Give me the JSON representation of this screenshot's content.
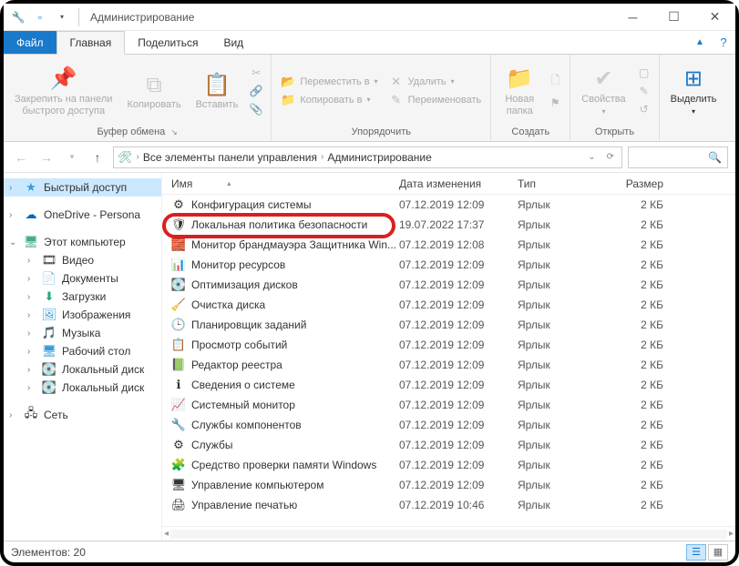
{
  "title": "Администрирование",
  "tabs": {
    "file": "Файл",
    "home": "Главная",
    "share": "Поделиться",
    "view": "Вид"
  },
  "ribbon": {
    "clipboard": {
      "pin": "Закрепить на панели\nбыстрого доступа",
      "copy": "Копировать",
      "paste": "Вставить",
      "label": "Буфер обмена"
    },
    "organize": {
      "moveTo": "Переместить в",
      "copyTo": "Копировать в",
      "delete": "Удалить",
      "rename": "Переименовать",
      "label": "Упорядочить"
    },
    "new": {
      "newFolder": "Новая\nпапка",
      "label": "Создать"
    },
    "open": {
      "props": "Свойства",
      "label": "Открыть"
    },
    "select": {
      "select": "Выделить",
      "label": ""
    }
  },
  "breadcrumb": {
    "root": "Все элементы панели управления",
    "current": "Администрирование"
  },
  "columns": {
    "name": "Имя",
    "date": "Дата изменения",
    "type": "Тип",
    "size": "Размер"
  },
  "nav": {
    "quick": "Быстрый доступ",
    "onedrive": "OneDrive - Persona",
    "pc": "Этот компьютер",
    "video": "Видео",
    "docs": "Документы",
    "downloads": "Загрузки",
    "pictures": "Изображения",
    "music": "Музыка",
    "desktop": "Рабочий стол",
    "disk1": "Локальный диск",
    "disk2": "Локальный диск",
    "network": "Сеть"
  },
  "items": [
    {
      "name": "Конфигурация системы",
      "date": "07.12.2019 12:09",
      "type": "Ярлык",
      "size": "2 КБ",
      "icon": "⚙"
    },
    {
      "name": "Локальная политика безопасности",
      "date": "19.07.2022 17:37",
      "type": "Ярлык",
      "size": "2 КБ",
      "icon": "🛡"
    },
    {
      "name": "Монитор брандмауэра Защитника Win...",
      "date": "07.12.2019 12:08",
      "type": "Ярлык",
      "size": "2 КБ",
      "icon": "🧱"
    },
    {
      "name": "Монитор ресурсов",
      "date": "07.12.2019 12:09",
      "type": "Ярлык",
      "size": "2 КБ",
      "icon": "📊"
    },
    {
      "name": "Оптимизация дисков",
      "date": "07.12.2019 12:09",
      "type": "Ярлык",
      "size": "2 КБ",
      "icon": "💽"
    },
    {
      "name": "Очистка диска",
      "date": "07.12.2019 12:09",
      "type": "Ярлык",
      "size": "2 КБ",
      "icon": "🧹"
    },
    {
      "name": "Планировщик заданий",
      "date": "07.12.2019 12:09",
      "type": "Ярлык",
      "size": "2 КБ",
      "icon": "🕒"
    },
    {
      "name": "Просмотр событий",
      "date": "07.12.2019 12:09",
      "type": "Ярлык",
      "size": "2 КБ",
      "icon": "📋"
    },
    {
      "name": "Редактор реестра",
      "date": "07.12.2019 12:09",
      "type": "Ярлык",
      "size": "2 КБ",
      "icon": "📗"
    },
    {
      "name": "Сведения о системе",
      "date": "07.12.2019 12:09",
      "type": "Ярлык",
      "size": "2 КБ",
      "icon": "ℹ"
    },
    {
      "name": "Системный монитор",
      "date": "07.12.2019 12:09",
      "type": "Ярлык",
      "size": "2 КБ",
      "icon": "📈"
    },
    {
      "name": "Службы компонентов",
      "date": "07.12.2019 12:09",
      "type": "Ярлык",
      "size": "2 КБ",
      "icon": "🔧"
    },
    {
      "name": "Службы",
      "date": "07.12.2019 12:09",
      "type": "Ярлык",
      "size": "2 КБ",
      "icon": "⚙"
    },
    {
      "name": "Средство проверки памяти Windows",
      "date": "07.12.2019 12:09",
      "type": "Ярлык",
      "size": "2 КБ",
      "icon": "🧩"
    },
    {
      "name": "Управление компьютером",
      "date": "07.12.2019 12:09",
      "type": "Ярлык",
      "size": "2 КБ",
      "icon": "🖥"
    },
    {
      "name": "Управление печатью",
      "date": "07.12.2019 10:46",
      "type": "Ярлык",
      "size": "2 КБ",
      "icon": "🖨"
    }
  ],
  "highlightIndex": 1,
  "status": {
    "count": "Элементов: 20"
  }
}
